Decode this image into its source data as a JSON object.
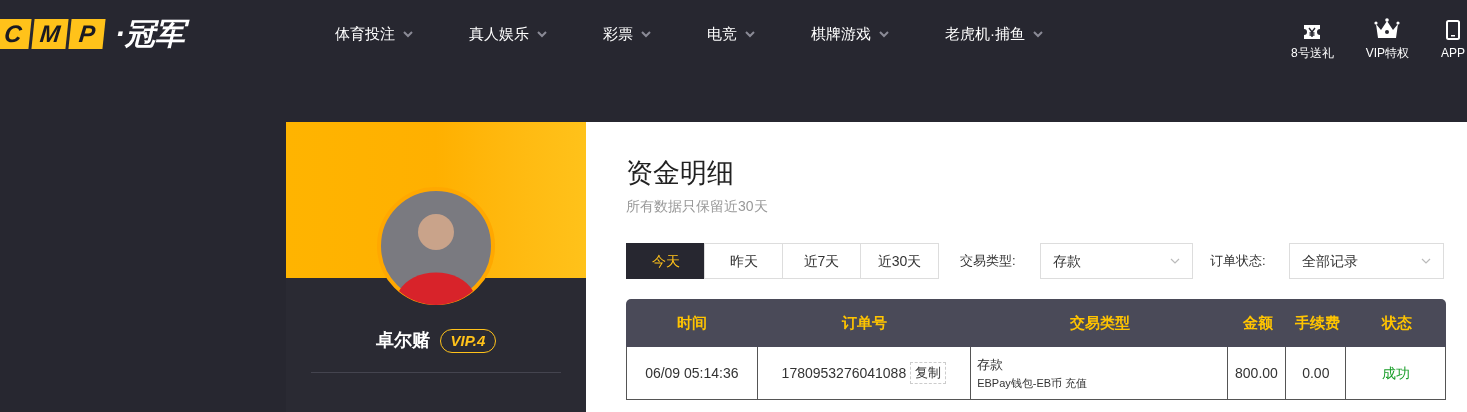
{
  "logo": {
    "letters": [
      "C",
      "M",
      "P"
    ],
    "text": "·冠军"
  },
  "nav": [
    {
      "label": "体育投注"
    },
    {
      "label": "真人娱乐"
    },
    {
      "label": "彩票"
    },
    {
      "label": "电竞"
    },
    {
      "label": "棋牌游戏"
    },
    {
      "label": "老虎机·捕鱼"
    }
  ],
  "shortcuts": [
    {
      "kind": "ticket",
      "label": "8号送礼"
    },
    {
      "kind": "crown",
      "label": "VIP特权"
    },
    {
      "kind": "phone",
      "label": "APP"
    }
  ],
  "profile": {
    "name": "卓尔赌",
    "vip": "VIP.4"
  },
  "page": {
    "title": "资金明细",
    "subtitle": "所有数据只保留近30天"
  },
  "ranges": [
    {
      "label": "今天",
      "selected": true
    },
    {
      "label": "昨天",
      "selected": false
    },
    {
      "label": "近7天",
      "selected": false
    },
    {
      "label": "近30天",
      "selected": false
    }
  ],
  "filters": [
    {
      "label": "交易类型:",
      "value": "存款"
    },
    {
      "label": "订单状态:",
      "value": "全部记录"
    }
  ],
  "table": {
    "columns": [
      "时间",
      "订单号",
      "交易类型",
      "金额",
      "手续费",
      "状态"
    ],
    "rows": [
      {
        "time": "06/09 05:14:36",
        "order": "1780953276041088",
        "copy": "复制",
        "type": "存款",
        "detail": "EBPay钱包-EB币 充值",
        "amount": "800.00",
        "fee": "0.00",
        "status": "成功",
        "success": true
      }
    ]
  }
}
